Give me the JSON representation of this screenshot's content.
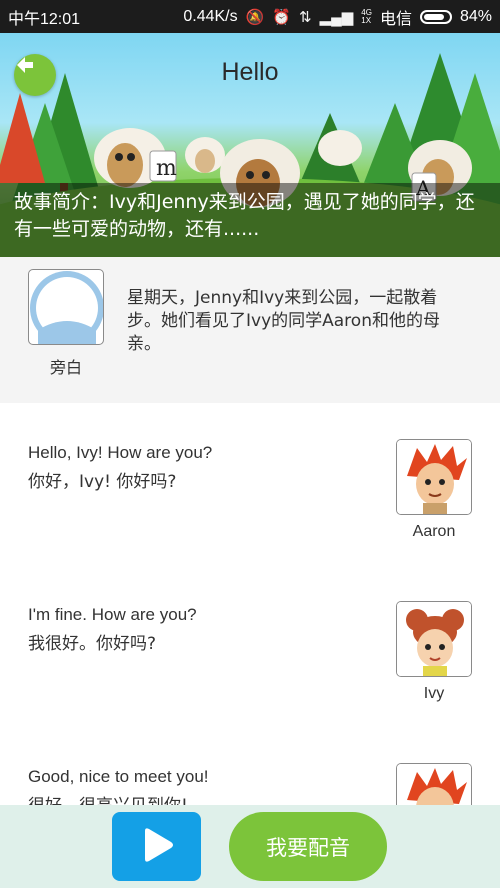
{
  "status_bar": {
    "time": "中午12:01",
    "speed": "0.44K/s",
    "network_top": "4G",
    "network_bottom": "1X",
    "carrier": "电信",
    "battery": "84%",
    "battery_level": 0.84
  },
  "header": {
    "title": "Hello",
    "back_icon": "arrow-left-icon"
  },
  "intro": {
    "text": "故事简介：Ivy和Jenny来到公园，遇见了她的同学，还有一些可爱的动物，还有......"
  },
  "narrator": {
    "name": "旁白",
    "text": "星期天，Jenny和Ivy来到公园，一起散着步。她们看见了Ivy的同学Aaron和他的母亲。"
  },
  "dialogues": [
    {
      "en": "Hello, Ivy! How are you?",
      "zh": "你好，Ivy! 你好吗?",
      "speaker": "Aaron"
    },
    {
      "en": "I'm fine. How are you?",
      "zh": "我很好。你好吗?",
      "speaker": "Ivy"
    },
    {
      "en": "Good, nice to meet you!",
      "zh": "很好，很高兴见到你!",
      "speaker": ""
    }
  ],
  "bottom": {
    "play_icon": "play-icon",
    "dub_label": "我要配音"
  },
  "colors": {
    "green": "#7cc43a",
    "blue": "#14a0e6",
    "bottom_bg": "#dff0ea"
  }
}
